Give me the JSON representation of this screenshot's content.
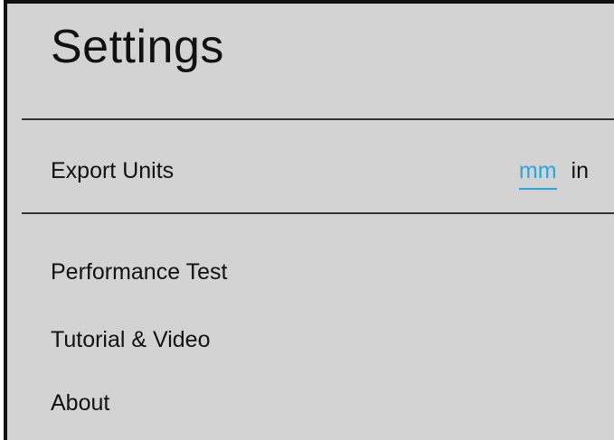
{
  "settings": {
    "title": "Settings",
    "export_units": {
      "label": "Export Units",
      "options": [
        "mm",
        "in"
      ],
      "selected": "mm"
    },
    "menu": [
      {
        "label": "Performance Test"
      },
      {
        "label": "Tutorial & Video"
      },
      {
        "label": "About"
      }
    ]
  },
  "colors": {
    "panel_background": "#d3d3d3",
    "accent": "#2aa5e0",
    "text": "#111111",
    "divider": "#333333"
  }
}
